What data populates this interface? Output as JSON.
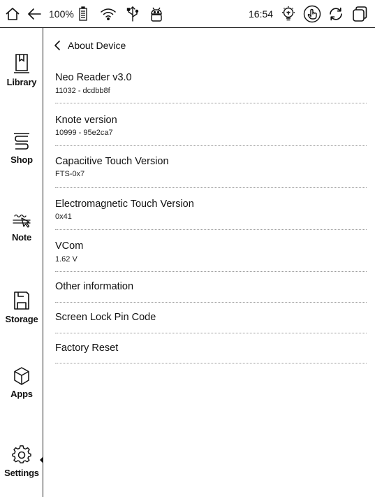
{
  "status_bar": {
    "battery_percent": "100%",
    "time": "16:54",
    "icons": [
      "home-icon",
      "back-arrow-icon",
      "battery-icon",
      "wifi-icon",
      "usb-icon",
      "android-icon",
      "lightbulb-icon",
      "touch-icon",
      "refresh-icon",
      "recent-apps-icon"
    ]
  },
  "sidebar": {
    "items": [
      {
        "label": "Library",
        "icon": "book-icon"
      },
      {
        "label": "Shop",
        "icon": "books-stack-icon"
      },
      {
        "label": "Note",
        "icon": "note-pen-icon"
      },
      {
        "label": "Storage",
        "icon": "floppy-disk-icon"
      },
      {
        "label": "Apps",
        "icon": "cube-icon"
      },
      {
        "label": "Settings",
        "icon": "gear-icon",
        "active": true
      }
    ]
  },
  "page": {
    "back_label": "About Device"
  },
  "rows": [
    {
      "title": "Neo Reader v3.0",
      "subtitle": "11032 - dcdbb8f"
    },
    {
      "title": "Knote version",
      "subtitle": "10999 - 95e2ca7"
    },
    {
      "title": "Capacitive Touch Version",
      "subtitle": "FTS-0x7"
    },
    {
      "title": "Electromagnetic Touch Version",
      "subtitle": "0x41"
    },
    {
      "title": "VCom",
      "subtitle": "1.62 V"
    },
    {
      "title": "Other information"
    },
    {
      "title": "Screen Lock Pin Code"
    },
    {
      "title": "Factory Reset"
    }
  ]
}
